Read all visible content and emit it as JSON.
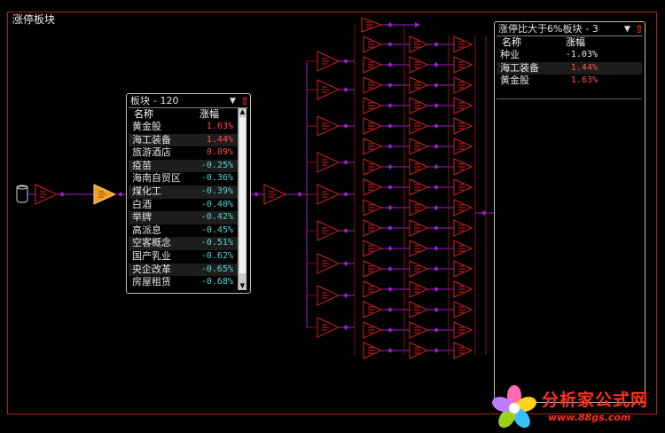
{
  "window": {
    "title": "涨停板块"
  },
  "panel_sectors": {
    "title": "板块",
    "count": "120",
    "columns": {
      "name": "名称",
      "change": "涨幅"
    },
    "rows": [
      {
        "name": "黄金股",
        "change": "1.63%",
        "dir": "pos"
      },
      {
        "name": "海工装备",
        "change": "1.44%",
        "dir": "pos"
      },
      {
        "name": "旅游酒店",
        "change": "0.09%",
        "dir": "pos"
      },
      {
        "name": "疫苗",
        "change": "-0.25%",
        "dir": "neg"
      },
      {
        "name": "海南自贸区",
        "change": "-0.36%",
        "dir": "neg"
      },
      {
        "name": "煤化工",
        "change": "-0.39%",
        "dir": "neg"
      },
      {
        "name": "白酒",
        "change": "-0.40%",
        "dir": "neg"
      },
      {
        "name": "举牌",
        "change": "-0.42%",
        "dir": "neg"
      },
      {
        "name": "高派息",
        "change": "-0.45%",
        "dir": "neg"
      },
      {
        "name": "空客概念",
        "change": "-0.51%",
        "dir": "neg"
      },
      {
        "name": "国产乳业",
        "change": "-0.62%",
        "dir": "neg"
      },
      {
        "name": "央企改革",
        "change": "-0.65%",
        "dir": "neg"
      },
      {
        "name": "房屋租赁",
        "change": "-0.68%",
        "dir": "neg"
      }
    ]
  },
  "panel_result": {
    "title": "涨停比大于6%板块",
    "count": "3",
    "columns": {
      "name": "名称",
      "change": "涨幅"
    },
    "rows": [
      {
        "name": "种业",
        "change": "-1.03%",
        "dir": "neg_white"
      },
      {
        "name": "海工装备",
        "change": "1.44%",
        "dir": "pos"
      },
      {
        "name": "黄金股",
        "change": "1.63%",
        "dir": "pos"
      }
    ]
  },
  "icons": {
    "dropdown": "chevron-down-icon",
    "sort": "arrow-up-icon",
    "database": "database-icon",
    "node": "triangle-node-icon",
    "logo": "pinwheel-logo-icon"
  },
  "logo": {
    "main": "分析家公式网",
    "url": "www.88gs.com"
  },
  "colors": {
    "background": "#000000",
    "frame": "#b02020",
    "node_stroke": "#d42020",
    "node_selected": "#f0a020",
    "connector": "#9a20c8",
    "positive": "#ff4d4d",
    "negative": "#55d4d4"
  }
}
